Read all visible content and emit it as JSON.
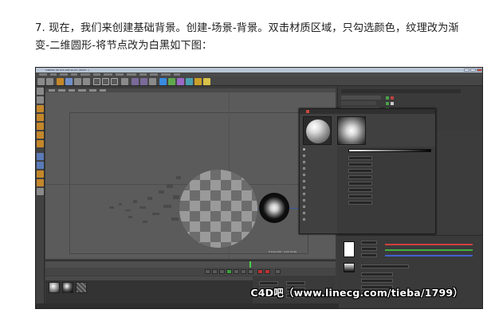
{
  "instruction": {
    "line1": "7. 现在，我们来创建基础背景。创建-场景-背景。双击材质区域，只勾选颜色，纹理改为渐",
    "line2": "变-二维圆形-将节点改为白黑如下图："
  },
  "app": {
    "window_title": "CINEMA 4D R15.008 Studio (RC83...)"
  },
  "material_editor": {
    "gradient": {
      "start_color": "#ffffff",
      "end_color": "#000000"
    }
  },
  "viewport": {
    "status_text": "Frame 000 : 4.00 10.00"
  },
  "watermark": "C4D吧（www.linecg.com/tieba/1799）"
}
